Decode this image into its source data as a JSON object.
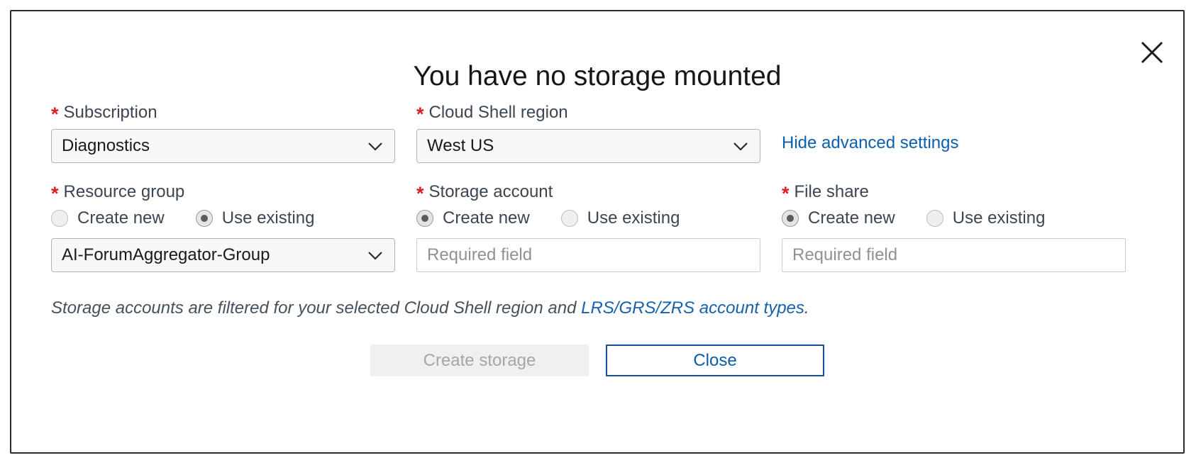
{
  "dialog": {
    "title": "You have no storage mounted",
    "close_icon": "close-icon",
    "close_label": "Close dialog"
  },
  "fields": {
    "subscription": {
      "label": "Subscription",
      "required_marker": "*",
      "value": "Diagnostics"
    },
    "region": {
      "label": "Cloud Shell region",
      "required_marker": "*",
      "value": "West US"
    },
    "advanced": {
      "link_label": "Hide advanced settings"
    },
    "resource_group": {
      "label": "Resource group",
      "required_marker": "*",
      "option_create": "Create new",
      "option_existing": "Use existing",
      "selected": "Use existing",
      "value": "AI-ForumAggregator-Group"
    },
    "storage_account": {
      "label": "Storage account",
      "required_marker": "*",
      "option_create": "Create new",
      "option_existing": "Use existing",
      "selected": "Create new",
      "placeholder": "Required field",
      "value": ""
    },
    "file_share": {
      "label": "File share",
      "required_marker": "*",
      "option_create": "Create new",
      "option_existing": "Use existing",
      "selected": "Create new",
      "placeholder": "Required field",
      "value": ""
    }
  },
  "note": {
    "prefix": "Storage accounts are filtered for your selected Cloud Shell region and ",
    "link": "LRS/GRS/ZRS account types",
    "suffix": "."
  },
  "buttons": {
    "primary_label": "Create storage",
    "primary_disabled": true,
    "secondary_label": "Close"
  },
  "colors": {
    "required_red": "#e01b24",
    "link_blue": "#0c5fb0",
    "accent_blue": "#12509b",
    "label_gray": "#3b4652",
    "disabled_gray": "#a6a6a6"
  }
}
